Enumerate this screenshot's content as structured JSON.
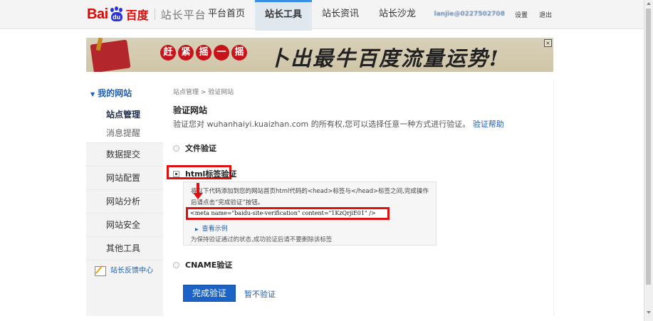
{
  "header": {
    "logo_text": "Bai",
    "logo_paw": "du",
    "logo_cn": "百度",
    "platform": "站长平台",
    "tabs": [
      {
        "label": "平台首页"
      },
      {
        "label": "站长工具"
      },
      {
        "label": "站长资讯"
      },
      {
        "label": "站长沙龙"
      }
    ],
    "username": "lanjie@0227502708",
    "settings": "设置",
    "logout": "退出"
  },
  "banner": {
    "circles": [
      "赶",
      "紧",
      "摇",
      "一",
      "摇"
    ],
    "slogan": "卜出最牛百度流量运势!",
    "close": "×"
  },
  "sidebar": {
    "my_sites": "我的网站",
    "sub_items": [
      {
        "label": "站点管理"
      },
      {
        "label": "消息提醒"
      }
    ],
    "items": [
      {
        "label": "数据提交"
      },
      {
        "label": "网站配置"
      },
      {
        "label": "网站分析"
      },
      {
        "label": "网站安全"
      },
      {
        "label": "其他工具"
      }
    ],
    "feedback": "站长反馈中心"
  },
  "main": {
    "breadcrumb": "站点管理 > 验证网站",
    "title": "验证网站",
    "desc_prefix": "验证您对 wuhanhaiyi.kuaizhan.com 的所有权,您可以选择任意一种方式进行验证。",
    "help_link": "验证帮助",
    "options": {
      "file": "文件验证",
      "html": "html标签验证",
      "cname": "CNAME验证"
    },
    "instructions": "将以下代码添加到您的网站首页html代码的<head>标签与</head>标签之间,完成操作后请点击“完成验证”按钮。",
    "meta_code": "<meta name=\"baidu-site-verification\" content=\"1KzQrjiE01\" />",
    "view_example": "查看示例",
    "keep_note": "为保持验证通过的状态,成功验证后请不要删除该标签",
    "complete_button": "完成验证",
    "skip_link": "暂不验证"
  }
}
